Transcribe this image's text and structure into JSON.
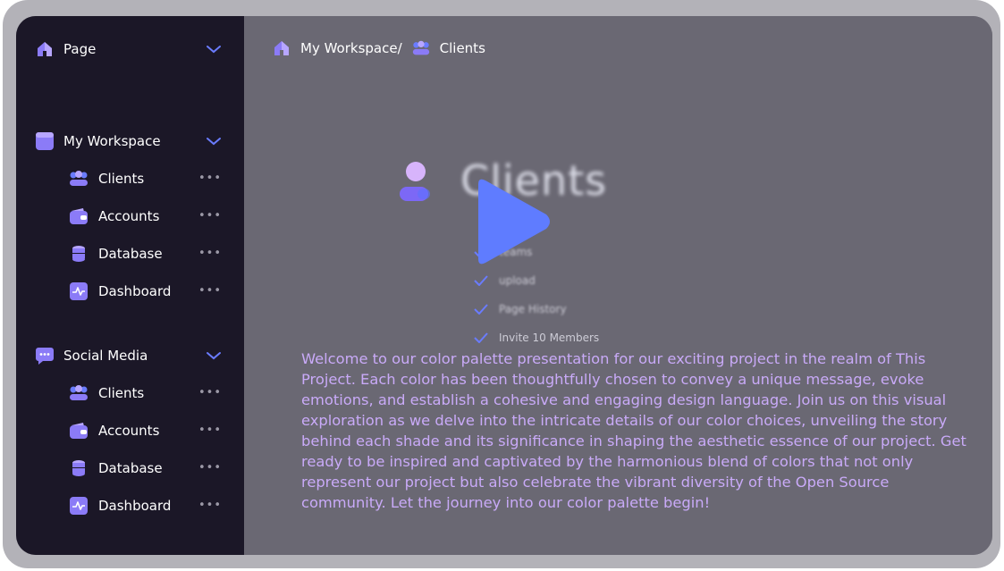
{
  "sidebar": {
    "top": {
      "label": "Page",
      "icon": "home-icon"
    },
    "sections": [
      {
        "label": "My Workspace",
        "icon": "workspace-icon",
        "items": [
          {
            "label": "Clients",
            "icon": "clients-icon",
            "more": "•••"
          },
          {
            "label": "Accounts",
            "icon": "wallet-icon",
            "more": "•••"
          },
          {
            "label": "Database",
            "icon": "database-icon",
            "more": "•••"
          },
          {
            "label": "Dashboard",
            "icon": "activity-icon",
            "more": "•••"
          }
        ]
      },
      {
        "label": "Social Media",
        "icon": "chat-icon",
        "items": [
          {
            "label": "Clients",
            "icon": "clients-icon",
            "more": "•••"
          },
          {
            "label": "Accounts",
            "icon": "wallet-icon",
            "more": "•••"
          },
          {
            "label": "Database",
            "icon": "database-icon",
            "more": "•••"
          },
          {
            "label": "Dashboard",
            "icon": "activity-icon",
            "more": "•••"
          }
        ]
      }
    ]
  },
  "breadcrumb": {
    "workspace": "My Workspace/",
    "current": "Clients"
  },
  "hero": {
    "title": "Clients",
    "features": [
      "teams",
      "upload",
      "Page History",
      "Invite 10 Members"
    ]
  },
  "description": "Welcome to our color palette presentation for our exciting project in the realm of This Project. Each color has been thoughtfully chosen to convey a unique message, evoke emotions, and establish a cohesive and engaging design language. Join us on this visual exploration as we delve into the intricate details of our color choices, unveiling the story behind each shade and its significance in shaping the aesthetic essence of our project. Get ready to be inspired and captivated by the harmonious blend of colors that not only represent our project but also celebrate the vibrant diversity of the Open Source community. Let the journey into our color palette begin!",
  "colors": {
    "sidebar_bg": "#1b1727",
    "main_bg": "#6a6873",
    "accent": "#6a7cff",
    "icon_purple": "#8b7bf7",
    "text_lilac": "#c9aaf8"
  }
}
